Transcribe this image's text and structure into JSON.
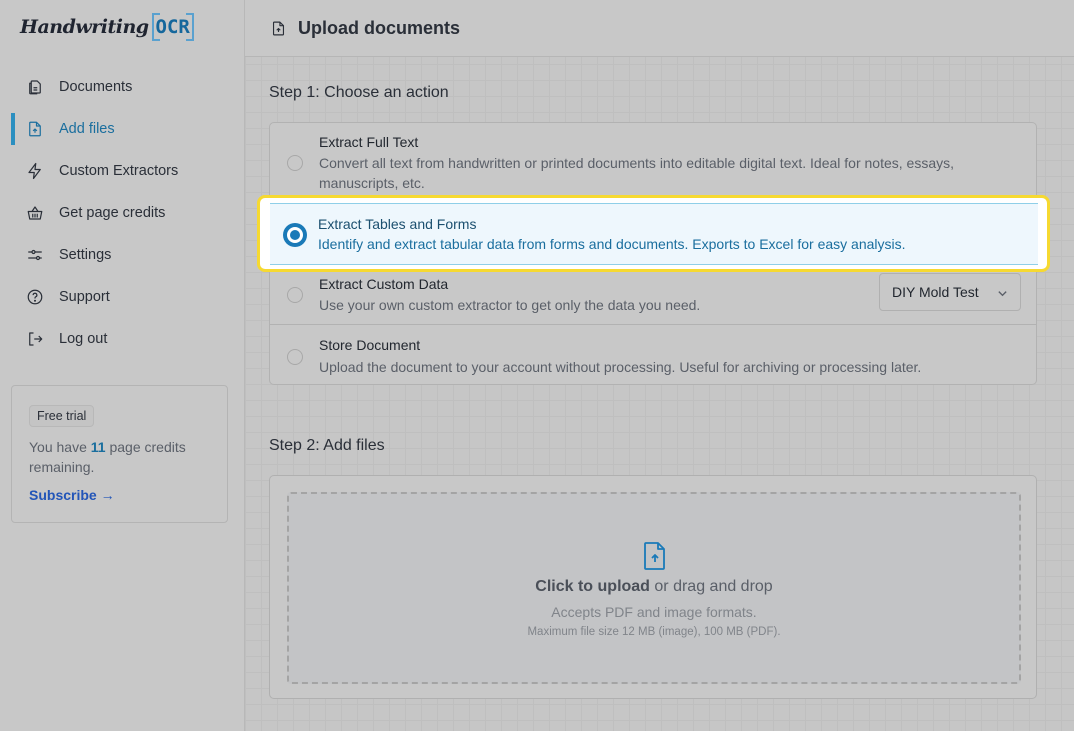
{
  "app": {
    "logo_script": "Handwriting",
    "logo_ocr": "OCR"
  },
  "sidebar": {
    "items": [
      {
        "label": "Documents",
        "icon": "documents-icon",
        "active": false
      },
      {
        "label": "Add files",
        "icon": "file-upload-icon",
        "active": true
      },
      {
        "label": "Custom Extractors",
        "icon": "lightning-icon",
        "active": false
      },
      {
        "label": "Get page credits",
        "icon": "basket-icon",
        "active": false
      },
      {
        "label": "Settings",
        "icon": "sliders-icon",
        "active": false
      },
      {
        "label": "Support",
        "icon": "question-circle-icon",
        "active": false
      },
      {
        "label": "Log out",
        "icon": "logout-icon",
        "active": false
      }
    ],
    "trial": {
      "badge": "Free trial",
      "text_before": "You have ",
      "credits": "11",
      "text_after": " page credits remaining.",
      "subscribe": "Subscribe →"
    }
  },
  "header": {
    "title": "Upload documents"
  },
  "step1": {
    "title": "Step 1: Choose an action",
    "options": [
      {
        "title": "Extract Full Text",
        "description": "Convert all text from handwritten or printed documents into editable digital text. Ideal for notes, essays, manuscripts, etc.",
        "selected": false
      },
      {
        "title": "Extract Tables and Forms",
        "description": "Identify and extract tabular data from forms and documents. Exports to Excel for easy analysis.",
        "selected": true
      },
      {
        "title": "Extract Custom Data",
        "description": "Use your own custom extractor to get only the data you need.",
        "selected": false,
        "select_value": "DIY Mold Test"
      },
      {
        "title": "Store Document",
        "description": "Upload the document to your account without processing. Useful for archiving or processing later.",
        "selected": false
      }
    ]
  },
  "step2": {
    "title": "Step 2: Add files",
    "click_label": "Click to upload",
    "drag_label": " or drag and drop",
    "accepts": "Accepts PDF and image formats.",
    "max_size": "Maximum file size 12 MB (image), 100 MB (PDF)."
  },
  "colors": {
    "accent": "#1a7ab8",
    "highlight_border": "#f6d931",
    "subscribe_link": "#2255b8"
  }
}
